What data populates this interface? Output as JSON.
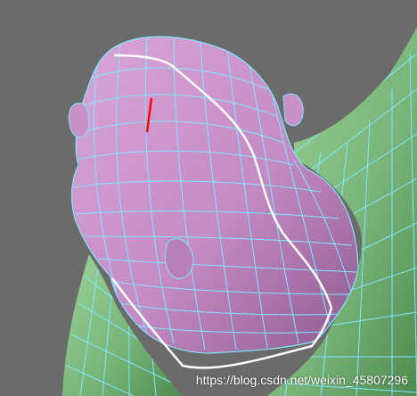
{
  "viewport": {
    "background": "#6b6b6b",
    "wire_color": "#7fe6ff",
    "selected_edge_color": "#ffffff",
    "highlight_edge_color": "#ff0000",
    "head_color": "#c58bc4",
    "body_color": "#77b377"
  },
  "watermark": {
    "text": "https://blog.csdn.net/weixin_45807296"
  }
}
